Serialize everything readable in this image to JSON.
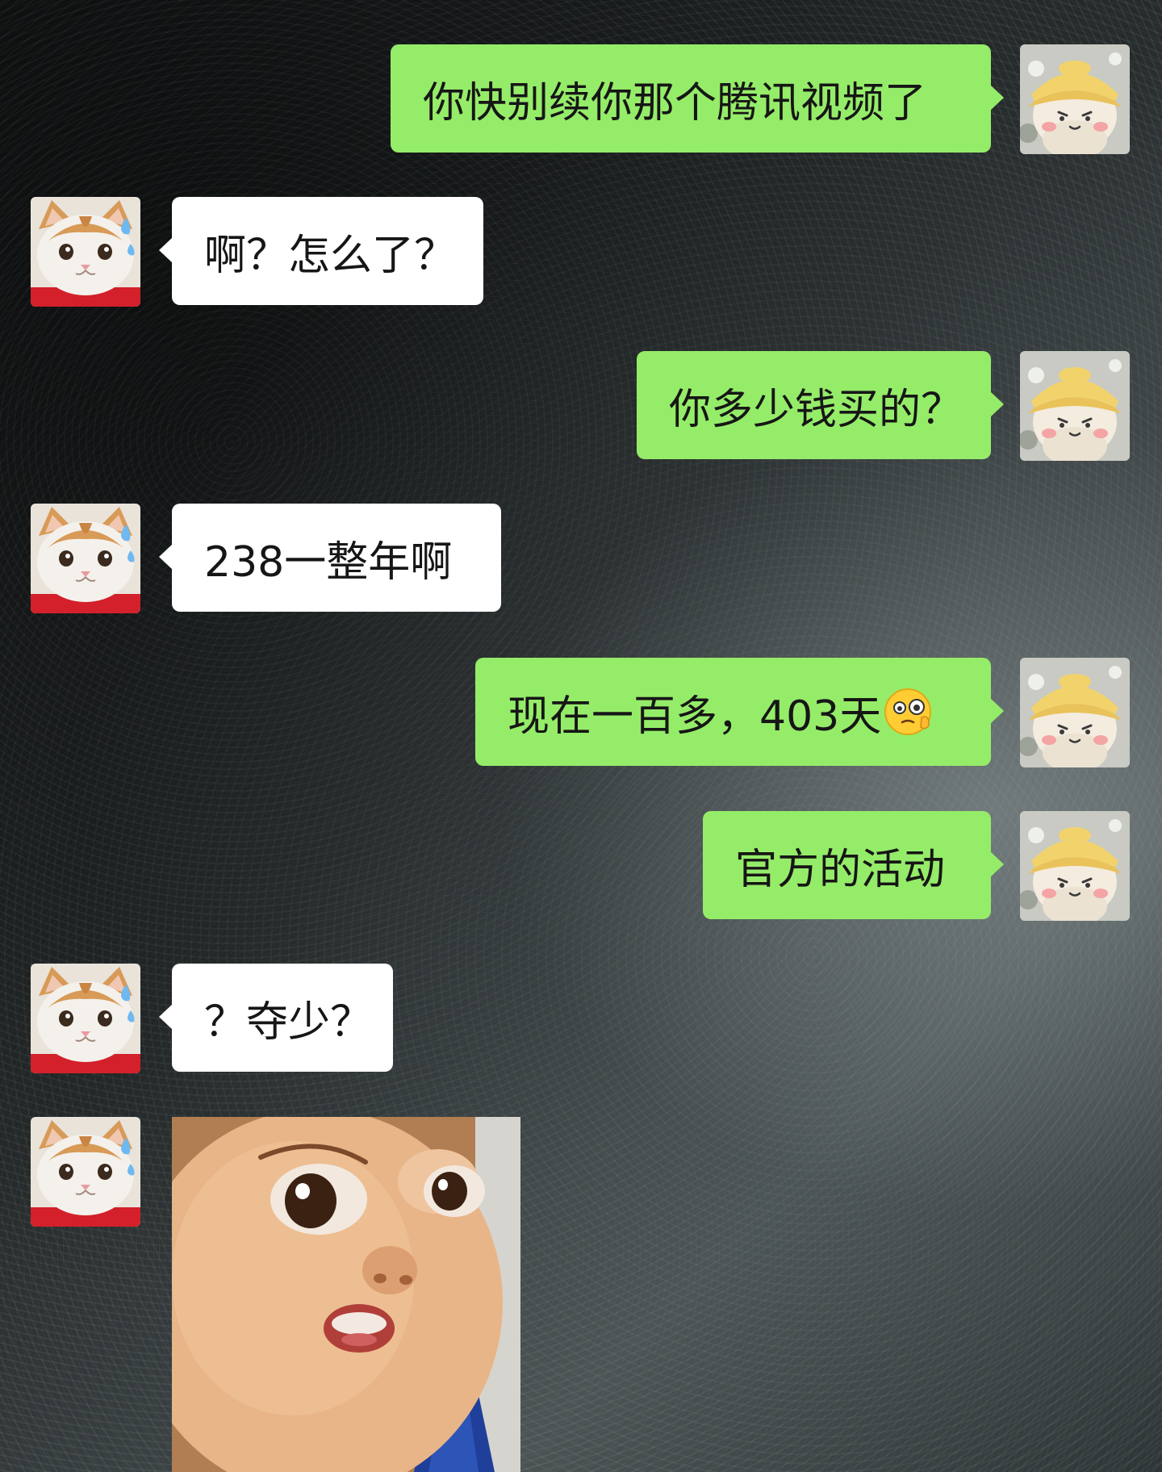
{
  "conversation": {
    "messages": [
      {
        "sender": "me",
        "text": "你快别续你那个腾讯视频了"
      },
      {
        "sender": "them",
        "text": "啊？怎么了？"
      },
      {
        "sender": "me",
        "text": "你多少钱买的？"
      },
      {
        "sender": "them",
        "text": "238一整年啊"
      },
      {
        "sender": "me",
        "text": "现在一百多，403天",
        "emoji": "monocle-thinking-face"
      },
      {
        "sender": "me",
        "text": "官方的活动"
      },
      {
        "sender": "them",
        "text": "？夺少？"
      },
      {
        "sender": "them",
        "type": "sticker",
        "image": "surprised-baby-face"
      }
    ]
  },
  "avatars": {
    "me": "yellow-hat-character",
    "them": "cat-with-sweat-drop"
  },
  "colors": {
    "outgoing_bubble": "#95ec69",
    "incoming_bubble": "#ffffff",
    "text": "#161616",
    "background": "#262b2c"
  }
}
